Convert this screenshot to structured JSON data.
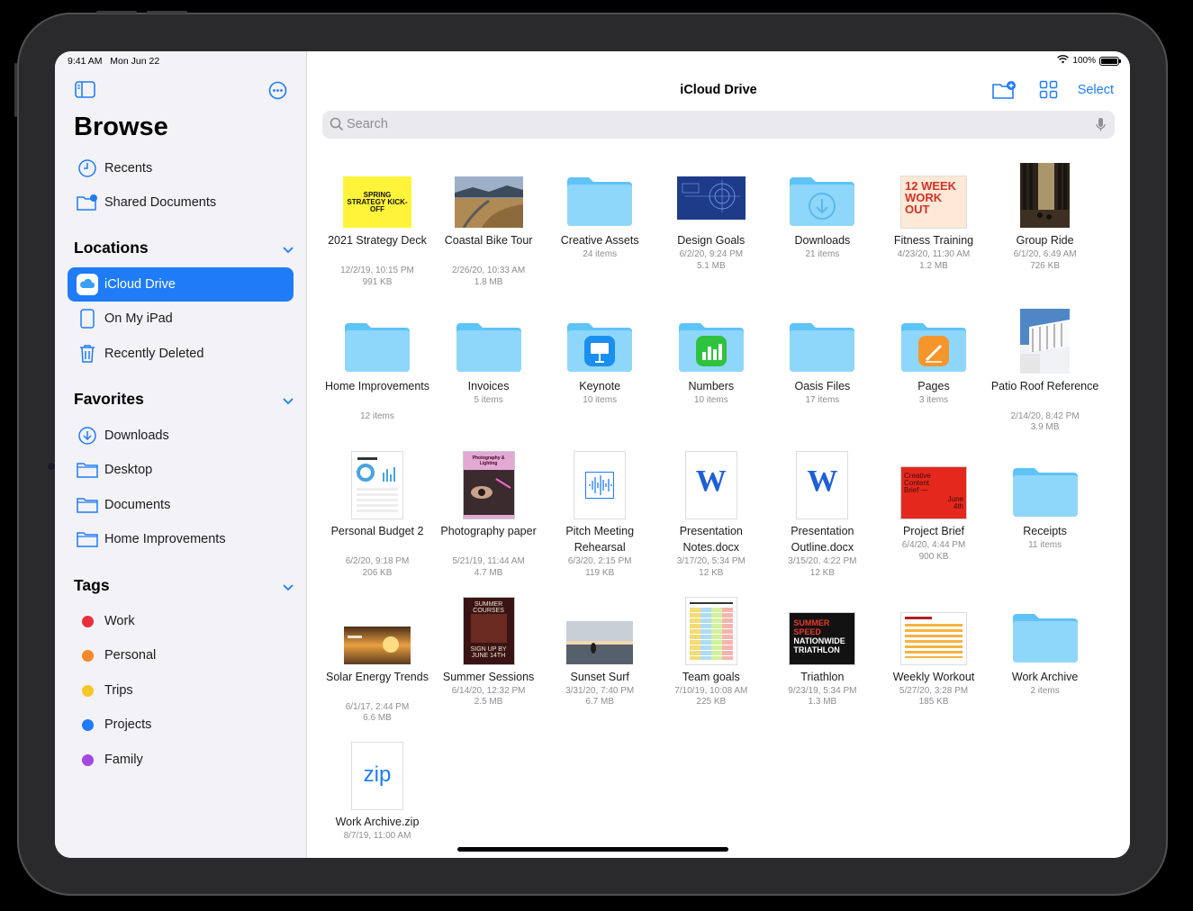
{
  "status": {
    "time": "9:41 AM",
    "date": "Mon Jun 22",
    "battery": "100%"
  },
  "sidebar": {
    "title": "Browse",
    "top_items": [
      {
        "label": "Recents",
        "icon": "clock-icon"
      },
      {
        "label": "Shared Documents",
        "icon": "shared-folder-icon"
      }
    ],
    "locations": {
      "heading": "Locations",
      "items": [
        {
          "label": "iCloud Drive",
          "icon": "icloud-icon",
          "active": true
        },
        {
          "label": "On My iPad",
          "icon": "ipad-icon"
        },
        {
          "label": "Recently Deleted",
          "icon": "trash-icon"
        }
      ]
    },
    "favorites": {
      "heading": "Favorites",
      "items": [
        {
          "label": "Downloads",
          "icon": "download-icon"
        },
        {
          "label": "Desktop",
          "icon": "folder-icon"
        },
        {
          "label": "Documents",
          "icon": "folder-icon"
        },
        {
          "label": "Home Improvements",
          "icon": "folder-icon"
        }
      ]
    },
    "tags": {
      "heading": "Tags",
      "items": [
        {
          "label": "Work",
          "color": "#e8303a"
        },
        {
          "label": "Personal",
          "color": "#f5882a"
        },
        {
          "label": "Trips",
          "color": "#f6c72b"
        },
        {
          "label": "Projects",
          "color": "#1f7cf6"
        },
        {
          "label": "Family",
          "color": "#a448e0"
        }
      ]
    }
  },
  "main": {
    "title": "iCloud Drive",
    "select_label": "Select",
    "search_placeholder": "Search",
    "items": [
      {
        "name": "2021 Strategy Deck",
        "meta": [
          "12/2/19, 10:15 PM",
          "991 KB"
        ],
        "kind": "doc-yellow",
        "thumb_text": "SPRING STRATEGY KICK-OFF"
      },
      {
        "name": "Coastal Bike Tour",
        "meta": [
          "2/26/20, 10:33 AM",
          "1.8 MB"
        ],
        "kind": "photo-coast"
      },
      {
        "name": "Creative Assets",
        "meta": [
          "24 items"
        ],
        "kind": "folder"
      },
      {
        "name": "Design Goals",
        "meta": [
          "6/2/20, 9:24 PM",
          "5.1 MB"
        ],
        "kind": "doc-blueprint"
      },
      {
        "name": "Downloads",
        "meta": [
          "21 items"
        ],
        "kind": "folder-download"
      },
      {
        "name": "Fitness Training",
        "meta": [
          "4/23/20, 11:30 AM",
          "1.2 MB"
        ],
        "kind": "doc-fitness",
        "thumb_text": "12 WEEK WORK OUT"
      },
      {
        "name": "Group Ride",
        "meta": [
          "6/1/20, 6:49 AM",
          "726 KB"
        ],
        "kind": "photo-forest"
      },
      {
        "name": "Home Improvements",
        "meta": [
          "12 items"
        ],
        "kind": "folder"
      },
      {
        "name": "Invoices",
        "meta": [
          "5 items"
        ],
        "kind": "folder"
      },
      {
        "name": "Keynote",
        "meta": [
          "10 items"
        ],
        "kind": "folder-keynote"
      },
      {
        "name": "Numbers",
        "meta": [
          "10 items"
        ],
        "kind": "folder-numbers"
      },
      {
        "name": "Oasis Files",
        "meta": [
          "17 items"
        ],
        "kind": "folder"
      },
      {
        "name": "Pages",
        "meta": [
          "3 items"
        ],
        "kind": "folder-pages"
      },
      {
        "name": "Patio Roof Reference",
        "meta": [
          "2/14/20, 8:42 PM",
          "3.9 MB"
        ],
        "kind": "photo-patio"
      },
      {
        "name": "Personal Budget 2",
        "meta": [
          "6/2/20, 9:18 PM",
          "206 KB"
        ],
        "kind": "doc-budget"
      },
      {
        "name": "Photography paper",
        "meta": [
          "5/21/19, 11:44 AM",
          "4.7 MB"
        ],
        "kind": "doc-photo-paper",
        "thumb_text": "Photography & Lighting"
      },
      {
        "name": "Pitch Meeting Rehearsal",
        "meta": [
          "6/3/20, 2:15 PM",
          "119 KB"
        ],
        "kind": "doc-audio"
      },
      {
        "name": "Presentation Notes.docx",
        "meta": [
          "3/17/20, 5:34 PM",
          "12 KB"
        ],
        "kind": "doc-word"
      },
      {
        "name": "Presentation Outline.docx",
        "meta": [
          "3/15/20, 4:22 PM",
          "12 KB"
        ],
        "kind": "doc-word"
      },
      {
        "name": "Project Brief",
        "meta": [
          "6/4/20, 4:44 PM",
          "900 KB"
        ],
        "kind": "doc-red",
        "thumb_text": "Creative Content Brief —",
        "thumb_text2": "June 4th"
      },
      {
        "name": "Receipts",
        "meta": [
          "11 items"
        ],
        "kind": "folder"
      },
      {
        "name": "Solar Energy Trends",
        "meta": [
          "6/1/17, 2:44 PM",
          "6.6 MB"
        ],
        "kind": "photo-solar"
      },
      {
        "name": "Summer Sessions",
        "meta": [
          "6/14/20, 12:32 PM",
          "2.5 MB"
        ],
        "kind": "doc-summer",
        "thumb_text": "SUMMER COURSES",
        "thumb_text2": "SIGN UP BY JUNE 14TH"
      },
      {
        "name": "Sunset Surf",
        "meta": [
          "3/31/20, 7:40 PM",
          "6.7 MB"
        ],
        "kind": "photo-surf"
      },
      {
        "name": "Team goals",
        "meta": [
          "7/10/19, 10:08 AM",
          "225 KB"
        ],
        "kind": "doc-table"
      },
      {
        "name": "Triathlon",
        "meta": [
          "9/23/19, 5:34 PM",
          "1.3 MB"
        ],
        "kind": "doc-triathlon",
        "thumb_text": "SUMMER SPEED",
        "thumb_text2": "NATIONWIDE TRIATHLON"
      },
      {
        "name": "Weekly Workout",
        "meta": [
          "5/27/20, 3:28 PM",
          "185 KB"
        ],
        "kind": "doc-workout"
      },
      {
        "name": "Work Archive",
        "meta": [
          "2 items"
        ],
        "kind": "folder"
      },
      {
        "name": "Work Archive.zip",
        "meta": [
          "8/7/19, 11:00 AM"
        ],
        "kind": "doc-zip",
        "thumb_text": "zip"
      }
    ]
  }
}
